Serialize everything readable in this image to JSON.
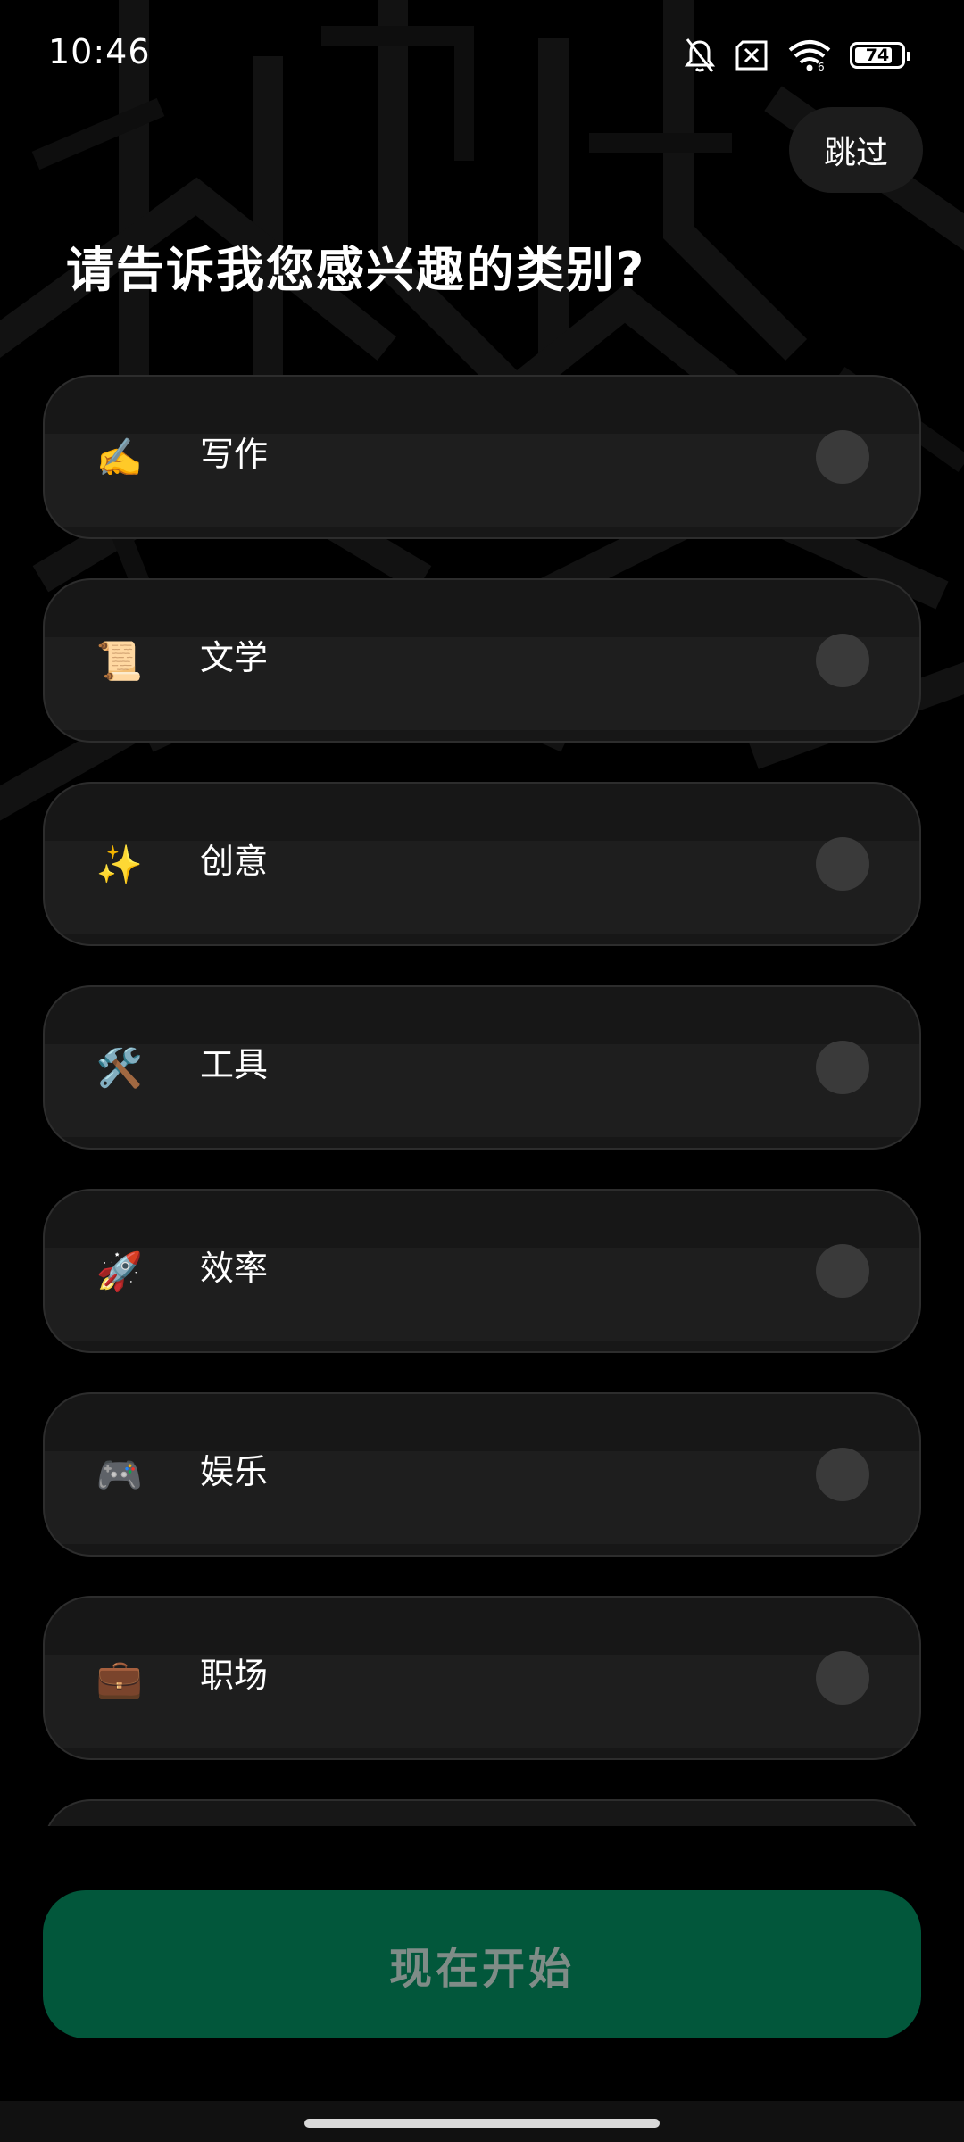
{
  "status_bar": {
    "time": "10:46",
    "battery_level": "74",
    "icons": [
      "bell-off-icon",
      "sim-blocked-icon",
      "wifi-icon",
      "battery-icon"
    ]
  },
  "skip_label": "跳过",
  "title": "请告诉我您感兴趣的类别?",
  "categories": [
    {
      "emoji": "✍️",
      "icon": "writing-hand-icon",
      "label": "写作"
    },
    {
      "emoji": "📜",
      "icon": "scroll-icon",
      "label": "文学"
    },
    {
      "emoji": "✨",
      "icon": "sparkles-icon",
      "label": "创意"
    },
    {
      "emoji": "🛠️",
      "icon": "tools-icon",
      "label": "工具"
    },
    {
      "emoji": "🚀",
      "icon": "rocket-icon",
      "label": "效率"
    },
    {
      "emoji": "🎮",
      "icon": "game-controller-icon",
      "label": "娱乐"
    },
    {
      "emoji": "💼",
      "icon": "briefcase-icon",
      "label": "职场"
    },
    {
      "emoji": "",
      "icon": "",
      "label": ""
    }
  ],
  "start_label": "现在开始",
  "colors": {
    "background": "#000000",
    "card": "#1e1e1e",
    "card_border": "#2d2d2d",
    "radio": "#3a3a3a",
    "primary_button": "#02573b",
    "primary_button_text": "#7f8c87"
  }
}
